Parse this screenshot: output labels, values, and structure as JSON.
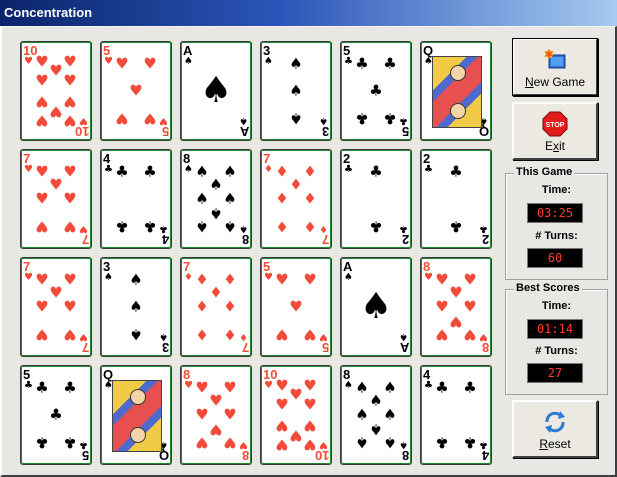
{
  "window": {
    "title": "Concentration"
  },
  "cards": [
    {
      "rank": "10",
      "suit": "♥",
      "color": "red"
    },
    {
      "rank": "5",
      "suit": "♥",
      "color": "red"
    },
    {
      "rank": "A",
      "suit": "♠",
      "color": "black"
    },
    {
      "rank": "3",
      "suit": "♠",
      "color": "black"
    },
    {
      "rank": "5",
      "suit": "♣",
      "color": "black"
    },
    {
      "rank": "Q",
      "suit": "♠",
      "color": "black"
    },
    {
      "rank": "7",
      "suit": "♥",
      "color": "red"
    },
    {
      "rank": "4",
      "suit": "♣",
      "color": "black"
    },
    {
      "rank": "8",
      "suit": "♠",
      "color": "black"
    },
    {
      "rank": "7",
      "suit": "♦",
      "color": "red"
    },
    {
      "rank": "2",
      "suit": "♣",
      "color": "black"
    },
    {
      "rank": "2",
      "suit": "♣",
      "color": "black"
    },
    {
      "rank": "7",
      "suit": "♥",
      "color": "red"
    },
    {
      "rank": "3",
      "suit": "♠",
      "color": "black"
    },
    {
      "rank": "7",
      "suit": "♦",
      "color": "red"
    },
    {
      "rank": "5",
      "suit": "♥",
      "color": "red"
    },
    {
      "rank": "A",
      "suit": "♠",
      "color": "black"
    },
    {
      "rank": "8",
      "suit": "♥",
      "color": "red"
    },
    {
      "rank": "5",
      "suit": "♣",
      "color": "black"
    },
    {
      "rank": "Q",
      "suit": "♠",
      "color": "black"
    },
    {
      "rank": "8",
      "suit": "♥",
      "color": "red"
    },
    {
      "rank": "10",
      "suit": "♥",
      "color": "red"
    },
    {
      "rank": "8",
      "suit": "♠",
      "color": "black"
    },
    {
      "rank": "4",
      "suit": "♣",
      "color": "black"
    }
  ],
  "buttons": {
    "new_game": {
      "label_pre": "",
      "label_accel": "N",
      "label_post": "ew Game",
      "icon": "new-game-icon"
    },
    "exit": {
      "label_pre": "E",
      "label_accel": "x",
      "label_post": "it",
      "icon": "stop-sign-icon",
      "sign_text": "STOP"
    },
    "reset": {
      "label_pre": "",
      "label_accel": "R",
      "label_post": "eset",
      "icon": "refresh-icon"
    }
  },
  "this_game": {
    "title": "This Game",
    "time_label": "Time:",
    "time_value": "03:25",
    "turns_label": "# Turns:",
    "turns_value": "60"
  },
  "best_scores": {
    "title": "Best Scores",
    "time_label": "Time:",
    "time_value": "01:14",
    "turns_label": "# Turns:",
    "turns_value": "27"
  },
  "colors": {
    "red_suit": "#f24b3a",
    "black_suit": "#000000",
    "led_text": "#ff3b2f",
    "card_border": "#1c8a2d",
    "title_gradient_start": "#0a246a",
    "title_gradient_end": "#a6caf0"
  }
}
